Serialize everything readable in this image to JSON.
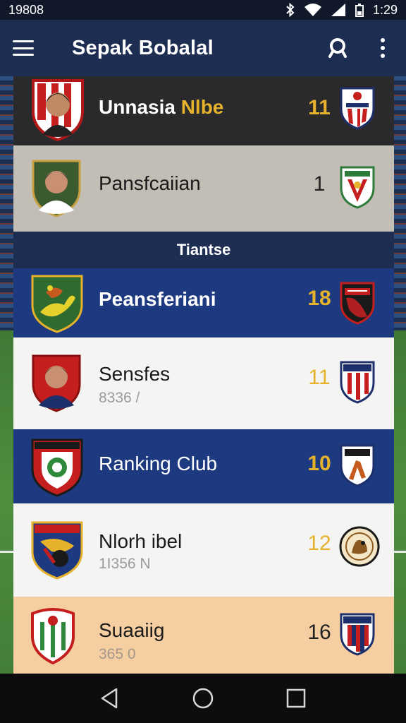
{
  "status_bar": {
    "time_left": "19808",
    "time_right": "1:29"
  },
  "app_bar": {
    "title": "Sepak Bobalal"
  },
  "rows_top": [
    {
      "name_a": "Unnasia ",
      "name_b": "Nlbe",
      "score": "11"
    },
    {
      "name": "Pansfcaiian",
      "score": "1"
    }
  ],
  "section": {
    "title": "Tiantse"
  },
  "rows": [
    {
      "name": "Peansferiani",
      "sub": "",
      "score": "18"
    },
    {
      "name": "Sensfes",
      "sub": "8336 /",
      "score": "11"
    },
    {
      "name": "Ranking Club",
      "sub": "",
      "score": "10"
    },
    {
      "name": "Nlorh ibel",
      "sub": "1I356 N",
      "score": "12"
    },
    {
      "name": "Suaaiig",
      "sub": "365 0",
      "score": "16"
    }
  ],
  "colors": {
    "accent": "#e6b22c",
    "navy": "#1e2d52",
    "blue_row": "#1d3a80",
    "peach_row": "#f5cfa2"
  }
}
